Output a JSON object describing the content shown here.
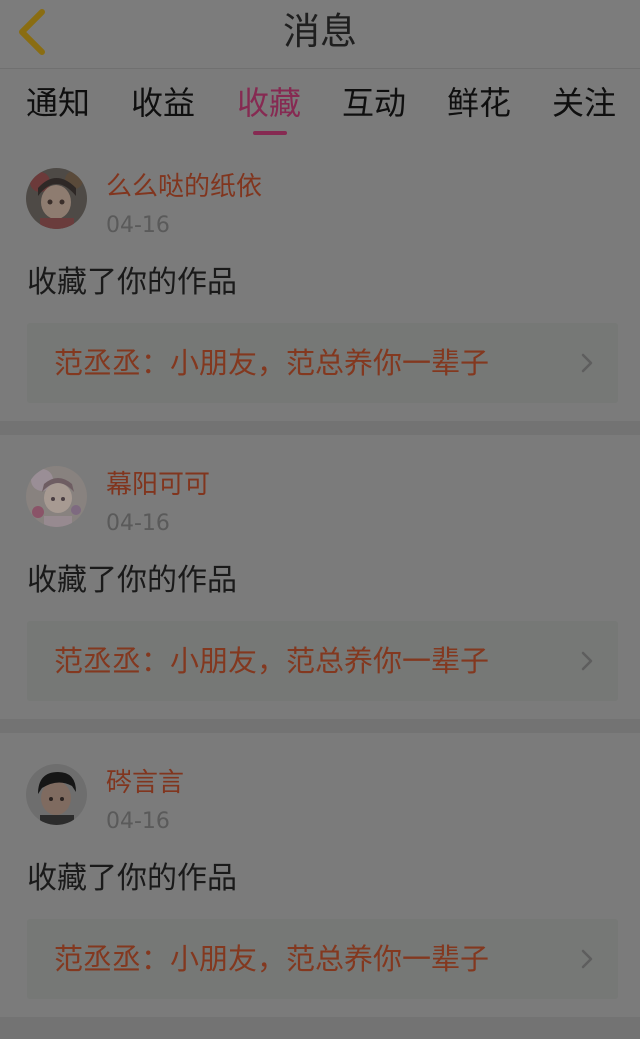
{
  "header": {
    "back_icon": "chevron-left-icon",
    "title": "消息"
  },
  "tabs": [
    {
      "label": "通知",
      "active": false
    },
    {
      "label": "收益",
      "active": false
    },
    {
      "label": "收藏",
      "active": true
    },
    {
      "label": "互动",
      "active": false
    },
    {
      "label": "鲜花",
      "active": false
    },
    {
      "label": "关注",
      "active": false
    }
  ],
  "messages": [
    {
      "user": "么么哒的纸依",
      "date": "04-16",
      "action": "收藏了你的作品",
      "work_title": "范丞丞：小朋友，范总养你一辈子"
    },
    {
      "user": "幕阳可可",
      "date": "04-16",
      "action": "收藏了你的作品",
      "work_title": "范丞丞：小朋友，范总养你一辈子"
    },
    {
      "user": "硶言言",
      "date": "04-16",
      "action": "收藏了你的作品",
      "work_title": "范丞丞：小朋友，范总养你一辈子"
    }
  ],
  "colors": {
    "accent": "#862a52",
    "back_icon": "#8a6d12",
    "username": "#81351e",
    "work_title": "#83381f"
  }
}
